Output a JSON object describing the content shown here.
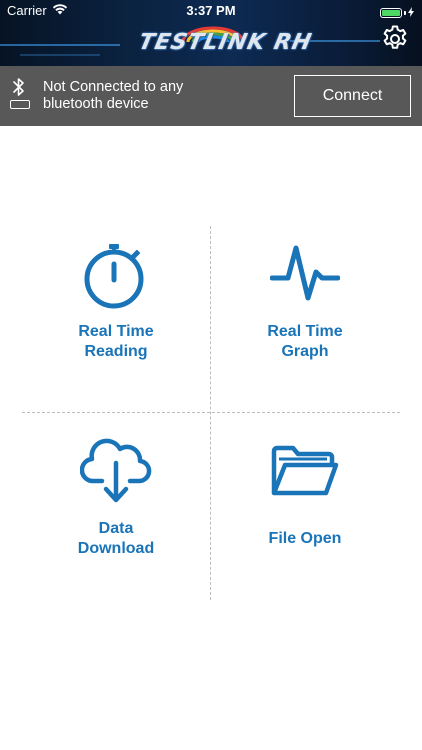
{
  "status_bar": {
    "carrier": "Carrier",
    "time": "3:37 PM"
  },
  "header": {
    "logo_text": "TESTLINK RH",
    "settings_icon": "gear-icon"
  },
  "connection": {
    "status_text": "Not Connected to any bluetooth device",
    "connect_label": "Connect",
    "bluetooth_icon": "bluetooth-icon",
    "battery_icon": "battery-icon"
  },
  "tiles": [
    {
      "label_line1": "Real Time",
      "label_line2": "Reading",
      "icon": "stopwatch-icon"
    },
    {
      "label_line1": "Real Time",
      "label_line2": "Graph",
      "icon": "pulse-graph-icon"
    },
    {
      "label_line1": "Data",
      "label_line2": "Download",
      "icon": "cloud-download-icon"
    },
    {
      "label_line1": "File Open",
      "icon": "folder-open-icon"
    }
  ],
  "colors": {
    "accent": "#1a74b8",
    "connection_bar": "#585858",
    "header_bg": "#0b2240"
  }
}
